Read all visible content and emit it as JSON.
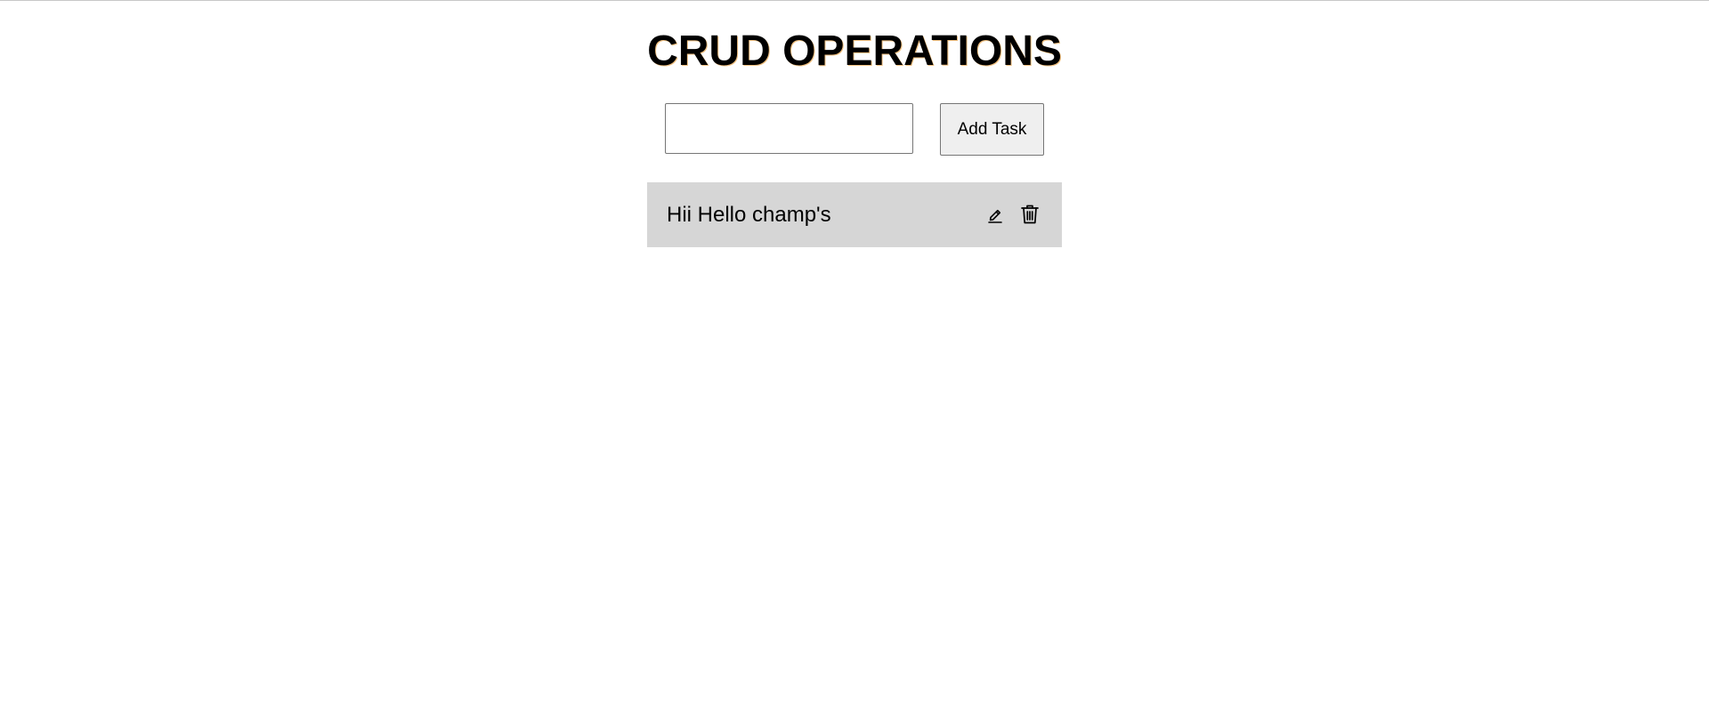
{
  "header": {
    "title": "CRUD OPERATIONS"
  },
  "form": {
    "input_value": "",
    "input_placeholder": "",
    "add_button_label": "Add Task"
  },
  "tasks": [
    {
      "text": "Hii Hello champ's",
      "edit_icon": "pencil-icon",
      "delete_icon": "trash-icon"
    }
  ],
  "colors": {
    "task_background": "#d6d6d6",
    "button_background": "#efefef"
  }
}
